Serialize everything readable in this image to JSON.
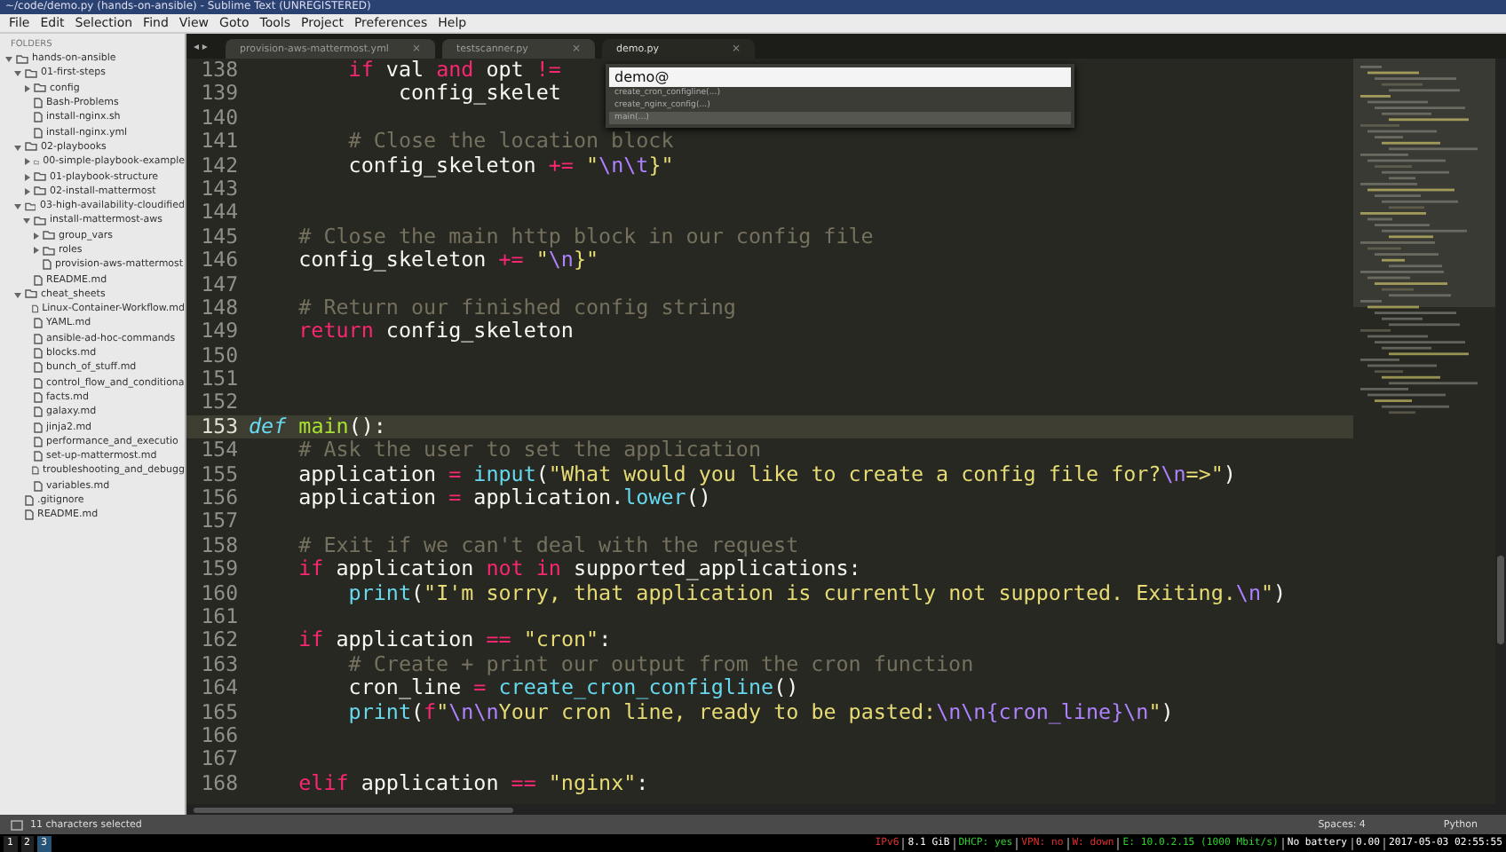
{
  "window": {
    "title": "~/code/demo.py (hands-on-ansible) - Sublime Text (UNREGISTERED)"
  },
  "menu": [
    "File",
    "Edit",
    "Selection",
    "Find",
    "View",
    "Goto",
    "Tools",
    "Project",
    "Preferences",
    "Help"
  ],
  "sidebar": {
    "heading": "FOLDERS",
    "tree": [
      {
        "name": "hands-on-ansible",
        "kind": "folder",
        "expanded": true,
        "children": [
          {
            "name": "01-first-steps",
            "kind": "folder",
            "expanded": true,
            "children": [
              {
                "name": "config",
                "kind": "folder",
                "expanded": false
              },
              {
                "name": "Bash-Problems",
                "kind": "file"
              },
              {
                "name": "install-nginx.sh",
                "kind": "file"
              },
              {
                "name": "install-nginx.yml",
                "kind": "file"
              }
            ]
          },
          {
            "name": "02-playbooks",
            "kind": "folder",
            "expanded": true,
            "children": [
              {
                "name": "00-simple-playbook-example",
                "kind": "folder",
                "expanded": false
              },
              {
                "name": "01-playbook-structure",
                "kind": "folder",
                "expanded": false
              },
              {
                "name": "02-install-mattermost",
                "kind": "folder",
                "expanded": false
              }
            ]
          },
          {
            "name": "03-high-availability-cloudified",
            "kind": "folder",
            "expanded": true,
            "children": [
              {
                "name": "install-mattermost-aws",
                "kind": "folder",
                "expanded": true,
                "children": [
                  {
                    "name": "group_vars",
                    "kind": "folder",
                    "expanded": false
                  },
                  {
                    "name": "roles",
                    "kind": "folder",
                    "expanded": false
                  },
                  {
                    "name": "provision-aws-mattermost",
                    "kind": "file"
                  }
                ]
              },
              {
                "name": "README.md",
                "kind": "file"
              }
            ]
          },
          {
            "name": "cheat_sheets",
            "kind": "folder",
            "expanded": true,
            "children": [
              {
                "name": "Linux-Container-Workflow.md",
                "kind": "file"
              },
              {
                "name": "YAML.md",
                "kind": "file"
              },
              {
                "name": "ansible-ad-hoc-commands",
                "kind": "file"
              },
              {
                "name": "blocks.md",
                "kind": "file"
              },
              {
                "name": "bunch_of_stuff.md",
                "kind": "file"
              },
              {
                "name": "control_flow_and_conditiona",
                "kind": "file"
              },
              {
                "name": "facts.md",
                "kind": "file"
              },
              {
                "name": "galaxy.md",
                "kind": "file"
              },
              {
                "name": "jinja2.md",
                "kind": "file"
              },
              {
                "name": "performance_and_executio",
                "kind": "file"
              },
              {
                "name": "set-up-mattermost.md",
                "kind": "file"
              },
              {
                "name": "troubleshooting_and_debugg",
                "kind": "file"
              },
              {
                "name": "variables.md",
                "kind": "file"
              }
            ]
          },
          {
            "name": ".gitignore",
            "kind": "file"
          },
          {
            "name": "README.md",
            "kind": "file"
          }
        ]
      }
    ]
  },
  "tab_nav": "◂ ▸",
  "tabs": [
    {
      "label": "provision-aws-mattermost.yml",
      "close": "×",
      "selected": false
    },
    {
      "label": "testscanner.py",
      "close": "×",
      "selected": false
    },
    {
      "label": "demo.py",
      "close": "×",
      "selected": true
    }
  ],
  "editor": {
    "lines": [
      {
        "number": "138",
        "current": false,
        "tokens": [
          {
            "kind": "kw",
            "text": "        if"
          },
          {
            "kind": "plain",
            "text": " val "
          },
          {
            "kind": "kw",
            "text": "and"
          },
          {
            "kind": "plain",
            "text": " opt "
          },
          {
            "kind": "kw",
            "text": "!="
          }
        ]
      },
      {
        "number": "139",
        "current": false,
        "tokens": [
          {
            "kind": "plain",
            "text": "            config_skelet"
          }
        ]
      },
      {
        "number": "140",
        "current": false
      },
      {
        "number": "141",
        "current": false,
        "tokens": [
          {
            "kind": "com",
            "text": "        # Close the location block"
          }
        ]
      },
      {
        "number": "142",
        "current": false,
        "tokens": [
          {
            "kind": "plain",
            "text": "        config_skeleton "
          },
          {
            "kind": "kw",
            "text": "+="
          },
          {
            "kind": "str",
            "text": " \""
          },
          {
            "kind": "esc",
            "text": "\\n\\t"
          },
          {
            "kind": "str",
            "text": "}\""
          }
        ]
      },
      {
        "number": "143",
        "current": false
      },
      {
        "number": "144",
        "current": false
      },
      {
        "number": "145",
        "current": false,
        "tokens": [
          {
            "kind": "com",
            "text": "    # Close the main http block in our config file"
          }
        ]
      },
      {
        "number": "146",
        "current": false,
        "tokens": [
          {
            "kind": "plain",
            "text": "    config_skeleton "
          },
          {
            "kind": "kw",
            "text": "+="
          },
          {
            "kind": "str",
            "text": " \""
          },
          {
            "kind": "esc",
            "text": "\\n"
          },
          {
            "kind": "str",
            "text": "}\""
          }
        ]
      },
      {
        "number": "147",
        "current": false
      },
      {
        "number": "148",
        "current": false,
        "tokens": [
          {
            "kind": "com",
            "text": "    # Return our finished config string"
          }
        ]
      },
      {
        "number": "149",
        "current": false,
        "tokens": [
          {
            "kind": "kw",
            "text": "    return"
          },
          {
            "kind": "plain",
            "text": " config_skeleton"
          }
        ]
      },
      {
        "number": "150",
        "current": false
      },
      {
        "number": "151",
        "current": false
      },
      {
        "number": "152",
        "current": false
      },
      {
        "number": "153",
        "current": true,
        "tokens": [
          {
            "kind": "def",
            "text": "def"
          },
          {
            "kind": "fn",
            "text": " main"
          },
          {
            "kind": "plain",
            "text": "():"
          }
        ]
      },
      {
        "number": "154",
        "current": false,
        "tokens": [
          {
            "kind": "com",
            "text": "    # Ask the user to set the application"
          }
        ]
      },
      {
        "number": "155",
        "current": false,
        "tokens": [
          {
            "kind": "plain",
            "text": "    application "
          },
          {
            "kind": "kw",
            "text": "="
          },
          {
            "kind": "builtin",
            "text": " input"
          },
          {
            "kind": "plain",
            "text": "("
          },
          {
            "kind": "str",
            "text": "\"What would you like to create a config file for?"
          },
          {
            "kind": "esc",
            "text": "\\n"
          },
          {
            "kind": "str",
            "text": "=>\""
          },
          {
            "kind": "plain",
            "text": ")"
          }
        ]
      },
      {
        "number": "156",
        "current": false,
        "tokens": [
          {
            "kind": "plain",
            "text": "    application "
          },
          {
            "kind": "kw",
            "text": "="
          },
          {
            "kind": "plain",
            "text": " application."
          },
          {
            "kind": "builtin",
            "text": "lower"
          },
          {
            "kind": "plain",
            "text": "()"
          }
        ]
      },
      {
        "number": "157",
        "current": false
      },
      {
        "number": "158",
        "current": false,
        "tokens": [
          {
            "kind": "com",
            "text": "    # Exit if we can't deal with the request"
          }
        ]
      },
      {
        "number": "159",
        "current": false,
        "tokens": [
          {
            "kind": "kw",
            "text": "    if"
          },
          {
            "kind": "plain",
            "text": " application "
          },
          {
            "kind": "kw",
            "text": "not in"
          },
          {
            "kind": "plain",
            "text": " supported_applications:"
          }
        ]
      },
      {
        "number": "160",
        "current": false,
        "tokens": [
          {
            "kind": "builtin",
            "text": "        print"
          },
          {
            "kind": "plain",
            "text": "("
          },
          {
            "kind": "str",
            "text": "\"I'm sorry, that application is currently not supported. Exiting."
          },
          {
            "kind": "esc",
            "text": "\\n"
          },
          {
            "kind": "str",
            "text": "\""
          },
          {
            "kind": "plain",
            "text": ")"
          }
        ]
      },
      {
        "number": "161",
        "current": false
      },
      {
        "number": "162",
        "current": false,
        "tokens": [
          {
            "kind": "kw",
            "text": "    if"
          },
          {
            "kind": "plain",
            "text": " application "
          },
          {
            "kind": "kw",
            "text": "=="
          },
          {
            "kind": "str",
            "text": " \"cron\""
          },
          {
            "kind": "plain",
            "text": ":"
          }
        ]
      },
      {
        "number": "163",
        "current": false,
        "tokens": [
          {
            "kind": "com",
            "text": "        # Create + print our output from the cron function"
          }
        ]
      },
      {
        "number": "164",
        "current": false,
        "tokens": [
          {
            "kind": "plain",
            "text": "        cron_line "
          },
          {
            "kind": "kw",
            "text": "="
          },
          {
            "kind": "builtin",
            "text": " create_cron_configline"
          },
          {
            "kind": "plain",
            "text": "()"
          }
        ]
      },
      {
        "number": "165",
        "current": false,
        "tokens": [
          {
            "kind": "builtin",
            "text": "        print"
          },
          {
            "kind": "plain",
            "text": "("
          },
          {
            "kind": "kw",
            "text": "f"
          },
          {
            "kind": "str",
            "text": "\""
          },
          {
            "kind": "esc",
            "text": "\\n\\n"
          },
          {
            "kind": "str",
            "text": "Your cron line, ready to be pasted:"
          },
          {
            "kind": "esc",
            "text": "\\n\\n{cron_line}\\n"
          },
          {
            "kind": "str",
            "text": "\""
          },
          {
            "kind": "plain",
            "text": ")"
          }
        ]
      },
      {
        "number": "166",
        "current": false
      },
      {
        "number": "167",
        "current": false
      },
      {
        "number": "168",
        "current": false,
        "tokens": [
          {
            "kind": "kw",
            "text": "    elif"
          },
          {
            "kind": "plain",
            "text": " application "
          },
          {
            "kind": "kw",
            "text": "=="
          },
          {
            "kind": "str",
            "text": " \"nginx\""
          },
          {
            "kind": "plain",
            "text": ":"
          }
        ]
      }
    ]
  },
  "goto_popup": {
    "value": "demo@",
    "items": [
      {
        "label": "create_cron_configline(...)",
        "selected": false
      },
      {
        "label": "create_nginx_config(...)",
        "selected": false
      },
      {
        "label": "main(...)",
        "selected": true
      }
    ]
  },
  "status_bar": {
    "selection": "11 characters selected",
    "indentation": "Spaces: 4",
    "syntax": "Python"
  },
  "system_bar": {
    "workspaces": [
      {
        "label": "1",
        "selected": false
      },
      {
        "label": "2",
        "selected": false
      },
      {
        "label": "3",
        "selected": true
      }
    ],
    "segments": [
      {
        "text": "IPv6",
        "color": "#e03030"
      },
      {
        "text": "8.1 GiB",
        "color": "#ffffff"
      },
      {
        "text": "DHCP: yes",
        "color": "#30d030"
      },
      {
        "text": "VPN: no",
        "color": "#e03030"
      },
      {
        "text": "W: down",
        "color": "#e03030"
      },
      {
        "text": "E: 10.0.2.15 (1000 Mbit/s)",
        "color": "#30d030"
      },
      {
        "text": "No battery",
        "color": "#ffffff"
      },
      {
        "text": "0.00",
        "color": "#ffffff"
      },
      {
        "text": "2017-05-03 02:55:55",
        "color": "#ffffff"
      }
    ]
  }
}
